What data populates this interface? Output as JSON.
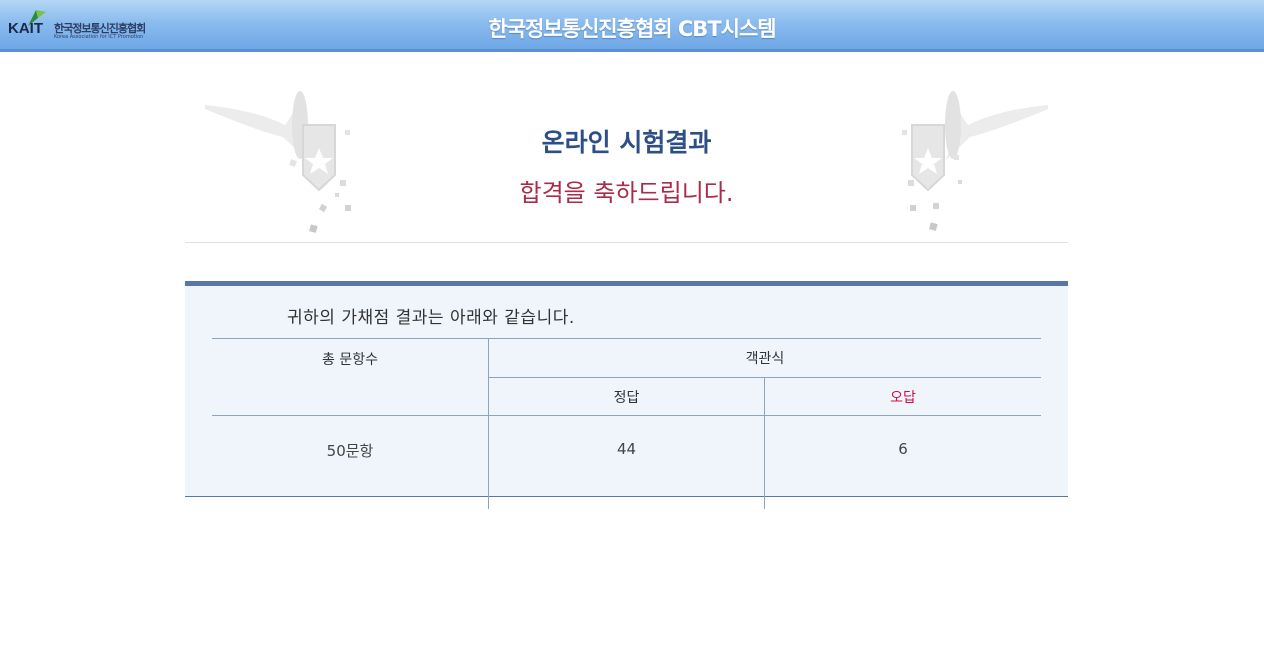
{
  "header": {
    "logo_text": "KAIT",
    "logo_org": "한국정보통신진흥협회",
    "logo_org_en": "Korea Association for ICT Promotion",
    "title": "한국정보통신진흥협회 CBT시스템"
  },
  "banner": {
    "title": "온라인 시험결과",
    "message": "합격을 축하드립니다."
  },
  "result": {
    "subtitle": "귀하의 가채점 결과는 아래와 같습니다.",
    "total_header": "총 문항수",
    "type_header": "객관식",
    "correct_header": "정답",
    "wrong_header": "오답",
    "total_value": "50문항",
    "correct_value": "44",
    "wrong_value": "6"
  },
  "colors": {
    "header_bar": "#8bbcee",
    "title_blue": "#2d4f86",
    "congrats_red": "#a92c4b",
    "wrong_red": "#cc1144",
    "panel_bg": "#f0f5fc",
    "panel_border": "#5a76a6"
  }
}
